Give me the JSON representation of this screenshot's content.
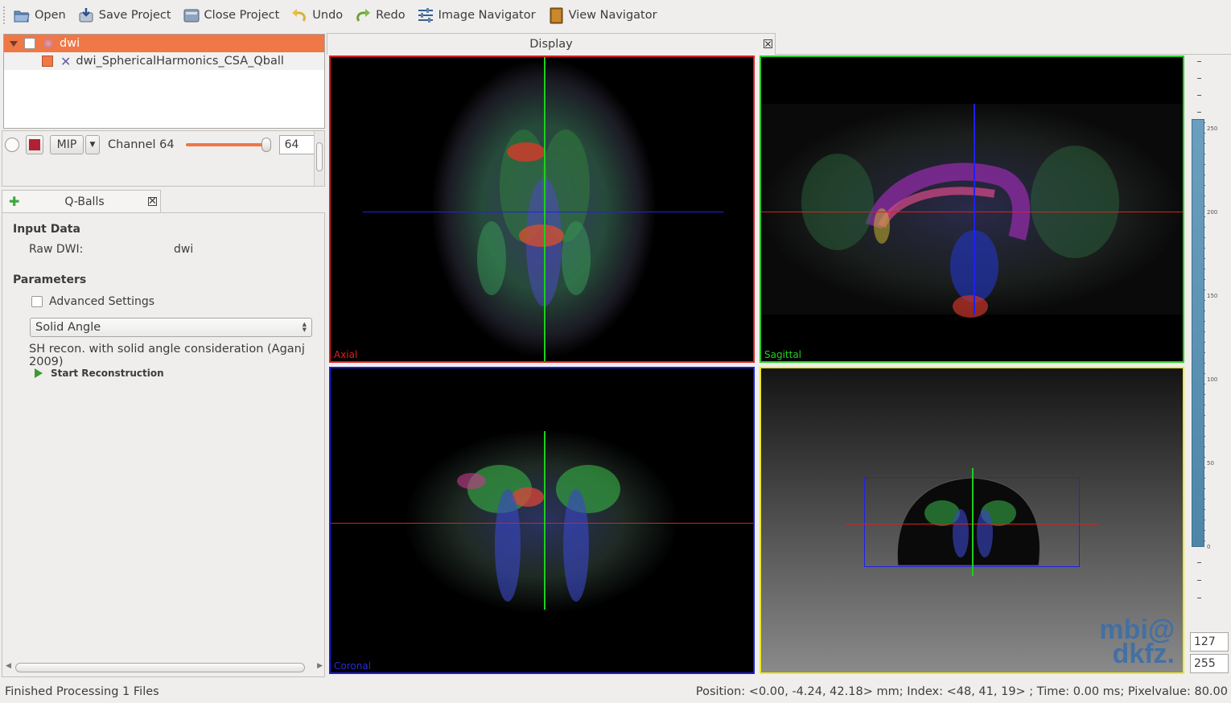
{
  "toolbar": {
    "open": "Open",
    "save_project": "Save Project",
    "close_project": "Close Project",
    "undo": "Undo",
    "redo": "Redo",
    "image_navigator": "Image Navigator",
    "view_navigator": "View Navigator"
  },
  "data_manager": {
    "items": [
      {
        "label": "dwi"
      },
      {
        "label": "dwi_SphericalHarmonics_CSA_Qball"
      }
    ]
  },
  "image_props": {
    "mip_label": "MIP",
    "channel_label": "Channel 64",
    "channel_value": "64",
    "slider_fraction": 1.0
  },
  "qballs": {
    "tab_label": "Q-Balls",
    "input_data_heading": "Input Data",
    "raw_dwi_label": "Raw DWI:",
    "raw_dwi_value": "dwi",
    "parameters_heading": "Parameters",
    "advanced_settings": "Advanced Settings",
    "method_selected": "Solid Angle",
    "method_description": "SH recon. with solid angle consideration (Aganj 2009)",
    "start_button": "Start Reconstruction"
  },
  "display": {
    "tab_label": "Display",
    "views": {
      "axial": "Axial",
      "sagittal": "Sagittal",
      "coronal": "Coronal"
    },
    "logo_line1": "mbi@",
    "logo_line2": "dkfz."
  },
  "level_window": {
    "ticks": [
      "250",
      "200",
      "150",
      "100",
      "50",
      "0"
    ],
    "level": "127",
    "window": "255"
  },
  "status": {
    "left": "Finished Processing 1 Files",
    "right": "Position: <0.00, -4.24, 42.18> mm; Index: <48, 41, 19> ; Time: 0.00 ms; Pixelvalue: 80.00"
  },
  "colors": {
    "selection": "#f07746",
    "axial_border": "#e01e1e",
    "sagittal_border": "#22d022",
    "coronal_border": "#1c1ce0",
    "view3d_border": "#ecec1a"
  }
}
